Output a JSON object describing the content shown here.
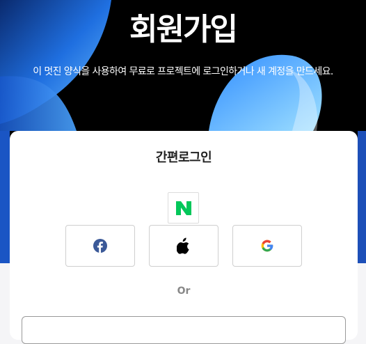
{
  "hero": {
    "title": "회원가입",
    "subtitle": "이 멋진 양식을 사용하여 무료로 프로젝트에 로그인하거나 새 계정을 만드세요."
  },
  "card": {
    "title": "간편로그인",
    "or_label": "Or"
  },
  "social": {
    "naver": {
      "icon": "naver-icon",
      "letter": "N",
      "color": "#03c75a"
    },
    "facebook": {
      "icon": "facebook-icon",
      "color": "#3b5998"
    },
    "apple": {
      "icon": "apple-icon",
      "color": "#000000"
    },
    "google": {
      "icon": "google-icon",
      "colors": [
        "#4285f4",
        "#ea4335",
        "#fbbc05",
        "#34a853"
      ]
    }
  },
  "colors": {
    "hero_bg": "#000000",
    "accent_blue": "#4aa3ff",
    "page_bg": "#f5f5f7"
  }
}
